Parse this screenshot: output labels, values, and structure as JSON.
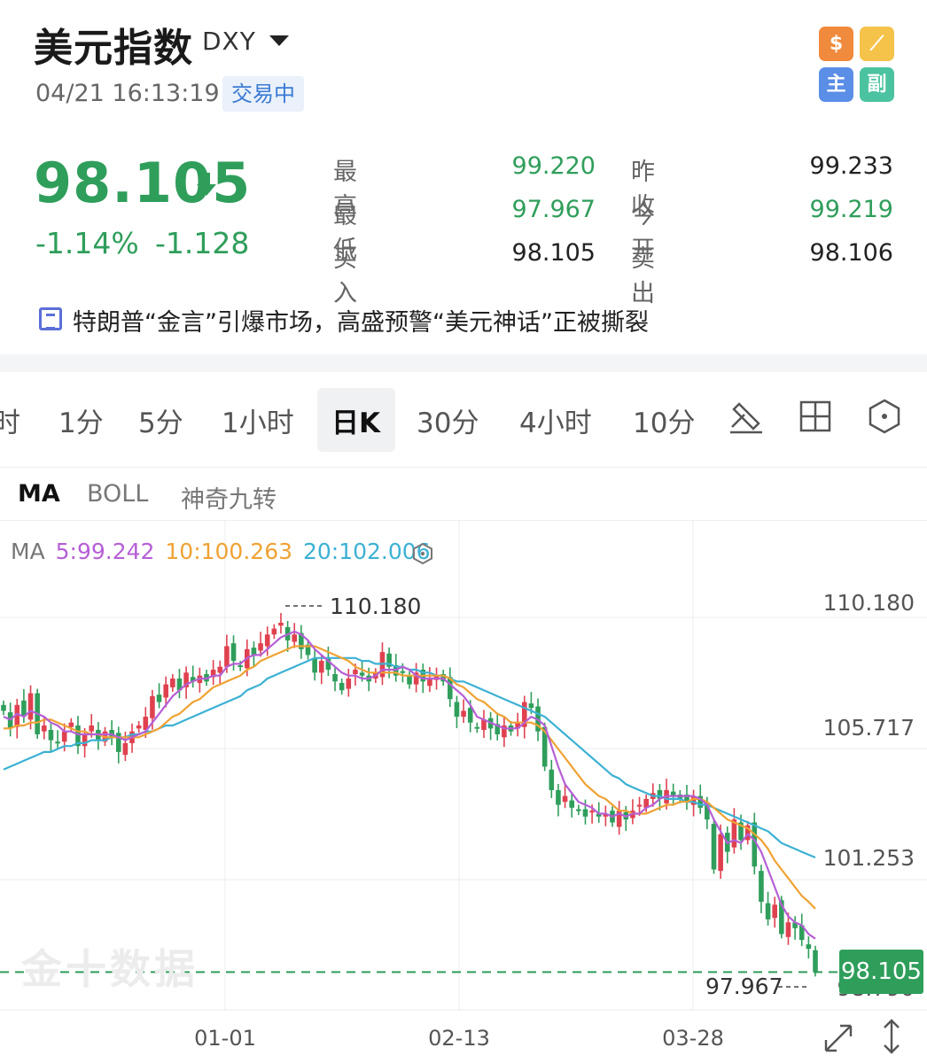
{
  "header": {
    "title": "美元指数",
    "symbol": "DXY",
    "datetime": "04/21 16:13:19",
    "status": "交易中"
  },
  "tools": [
    {
      "name": "dollar-icon",
      "glyph": "$"
    },
    {
      "name": "draw-line-icon",
      "glyph": "⟋"
    },
    {
      "name": "main-chart-icon",
      "glyph": "主"
    },
    {
      "name": "sub-chart-icon",
      "glyph": "副"
    }
  ],
  "quote": {
    "price": "98.105",
    "change_pct": "-1.14%",
    "change": "-1.128",
    "stats": {
      "high_label": "最高",
      "high": "99.220",
      "prev_close_label": "昨收",
      "prev_close": "99.233",
      "low_label": "最低",
      "low": "97.967",
      "open_label": "今开",
      "open": "99.219",
      "bid_label": "买入",
      "bid": "98.105",
      "ask_label": "卖出",
      "ask": "98.106"
    }
  },
  "news": {
    "headline": "特朗普“金言”引爆市场，高盛预警“美元神话”正被撕裂"
  },
  "period_tabs": [
    "时",
    "1分",
    "5分",
    "1小时",
    "日K",
    "30分",
    "4小时",
    "10分"
  ],
  "active_period": "日K",
  "indicator_tabs": [
    "MA",
    "BOLL",
    "神奇九转"
  ],
  "active_indicator": "MA",
  "ma": {
    "label": "MA",
    "ma5": "5:99.242",
    "ma10": "10:100.263",
    "ma20": "20:102.006",
    "colors": {
      "ma5": "#b65fd6",
      "ma10": "#f0a233",
      "ma20": "#3cb1d4"
    }
  },
  "colors": {
    "up": "#e0414f",
    "down": "#2f9e5b",
    "accent": "#3a7bd5"
  },
  "watermark": "金十数据",
  "chart_data": {
    "type": "candlestick",
    "y_ticks": [
      "110.180",
      "105.717",
      "101.253",
      "98.790"
    ],
    "x_ticks": [
      "01-01",
      "02-13",
      "03-28"
    ],
    "high_label": "110.180",
    "low_label": "97.967",
    "last_price": "98.105",
    "ylim": [
      97.0,
      111.5
    ],
    "close_series": [
      107.0,
      106.4,
      107.2,
      106.8,
      107.6,
      106.2,
      106.5,
      106.0,
      105.9,
      106.3,
      106.6,
      105.8,
      106.2,
      106.5,
      106.0,
      106.3,
      106.1,
      105.6,
      105.9,
      106.3,
      106.5,
      106.8,
      107.5,
      107.3,
      107.9,
      108.1,
      107.7,
      108.3,
      108.0,
      108.2,
      108.0,
      108.4,
      108.5,
      109.2,
      108.7,
      108.5,
      109.1,
      108.9,
      109.3,
      109.6,
      109.8,
      110.0,
      109.4,
      109.6,
      109.1,
      108.9,
      108.3,
      108.7,
      108.4,
      108.0,
      107.7,
      108.1,
      108.4,
      108.2,
      108.0,
      108.3,
      109.0,
      108.5,
      108.2,
      108.3,
      107.9,
      108.3,
      108.0,
      108.1,
      108.2,
      108.0,
      107.4,
      106.8,
      107.0,
      106.6,
      106.4,
      106.7,
      106.4,
      106.2,
      106.5,
      106.3,
      106.6,
      107.3,
      107.1,
      106.3,
      105.1,
      104.3,
      103.8,
      104.1,
      103.7,
      103.6,
      103.4,
      103.6,
      103.4,
      103.5,
      103.2,
      103.6,
      103.3,
      103.6,
      103.8,
      104.0,
      104.2,
      104.0,
      104.3,
      104.1,
      104.0,
      103.9,
      104.1,
      103.7,
      103.3,
      101.6,
      102.8,
      102.2,
      103.3,
      102.6,
      103.1,
      101.7,
      100.5,
      99.9,
      100.4,
      99.4,
      99.8,
      99.6,
      99.2,
      98.9,
      98.105
    ],
    "ma5": [
      106.8,
      106.7,
      106.9,
      106.8,
      107.0,
      106.9,
      106.8,
      106.6,
      106.5,
      106.3,
      106.3,
      106.2,
      106.2,
      106.2,
      106.2,
      106.2,
      106.2,
      106.1,
      106.0,
      106.1,
      106.2,
      106.3,
      106.6,
      106.9,
      107.2,
      107.5,
      107.7,
      107.9,
      108.0,
      108.1,
      108.1,
      108.2,
      108.2,
      108.5,
      108.6,
      108.6,
      108.8,
      108.9,
      108.9,
      109.1,
      109.3,
      109.5,
      109.6,
      109.7,
      109.6,
      109.4,
      109.1,
      108.9,
      108.7,
      108.5,
      108.3,
      108.2,
      108.2,
      108.1,
      108.1,
      108.2,
      108.4,
      108.4,
      108.4,
      108.5,
      108.4,
      108.2,
      108.1,
      108.1,
      108.1,
      108.1,
      107.9,
      107.7,
      107.5,
      107.2,
      106.8,
      106.7,
      106.6,
      106.5,
      106.4,
      106.4,
      106.4,
      106.6,
      106.8,
      106.7,
      106.5,
      105.8,
      105.1,
      104.5,
      104.2,
      103.9,
      103.8,
      103.7,
      103.5,
      103.5,
      103.4,
      103.5,
      103.4,
      103.5,
      103.5,
      103.7,
      103.8,
      104.0,
      104.1,
      104.1,
      104.1,
      104.1,
      104.1,
      104.0,
      103.8,
      103.3,
      102.9,
      102.5,
      102.6,
      102.5,
      102.8,
      102.6,
      102.2,
      101.6,
      101.0,
      100.4,
      100.0,
      99.8,
      99.7,
      99.4,
      99.242
    ],
    "ma10": [
      106.4,
      106.4,
      106.5,
      106.5,
      106.6,
      106.6,
      106.7,
      106.7,
      106.6,
      106.5,
      106.4,
      106.3,
      106.3,
      106.2,
      106.2,
      106.1,
      106.1,
      106.1,
      106.1,
      106.1,
      106.1,
      106.2,
      106.3,
      106.4,
      106.6,
      106.8,
      106.9,
      107.1,
      107.3,
      107.4,
      107.6,
      107.8,
      107.9,
      108.0,
      108.1,
      108.2,
      108.4,
      108.5,
      108.7,
      108.8,
      108.9,
      109.0,
      109.1,
      109.2,
      109.2,
      109.2,
      109.2,
      109.1,
      109.0,
      108.9,
      108.8,
      108.7,
      108.5,
      108.4,
      108.3,
      108.3,
      108.3,
      108.3,
      108.3,
      108.2,
      108.2,
      108.2,
      108.2,
      108.2,
      108.2,
      108.2,
      108.1,
      107.9,
      107.8,
      107.6,
      107.4,
      107.3,
      107.1,
      106.9,
      106.8,
      106.6,
      106.6,
      106.6,
      106.6,
      106.5,
      106.3,
      106.0,
      105.7,
      105.4,
      105.1,
      104.8,
      104.5,
      104.3,
      104.1,
      104.0,
      103.8,
      103.6,
      103.6,
      103.5,
      103.5,
      103.5,
      103.6,
      103.7,
      103.8,
      103.8,
      103.9,
      103.9,
      104.0,
      104.0,
      103.9,
      103.7,
      103.5,
      103.3,
      103.2,
      103.1,
      103.0,
      102.8,
      102.6,
      102.3,
      101.9,
      101.6,
      101.3,
      101.0,
      100.7,
      100.5,
      100.263
    ],
    "ma20": [
      105.0,
      105.1,
      105.2,
      105.3,
      105.4,
      105.5,
      105.6,
      105.6,
      105.7,
      105.8,
      105.8,
      105.9,
      105.9,
      106.0,
      106.0,
      106.0,
      106.1,
      106.1,
      106.1,
      106.2,
      106.2,
      106.3,
      106.3,
      106.4,
      106.5,
      106.5,
      106.6,
      106.7,
      106.8,
      106.9,
      107.0,
      107.1,
      107.2,
      107.3,
      107.4,
      107.5,
      107.7,
      107.8,
      107.9,
      108.1,
      108.2,
      108.3,
      108.4,
      108.5,
      108.6,
      108.7,
      108.8,
      108.8,
      108.8,
      108.8,
      108.8,
      108.8,
      108.8,
      108.7,
      108.7,
      108.6,
      108.6,
      108.6,
      108.5,
      108.5,
      108.4,
      108.4,
      108.3,
      108.3,
      108.2,
      108.2,
      108.1,
      108.0,
      108.0,
      107.9,
      107.8,
      107.7,
      107.6,
      107.5,
      107.4,
      107.3,
      107.2,
      107.1,
      107.0,
      106.9,
      106.8,
      106.6,
      106.4,
      106.2,
      106.0,
      105.8,
      105.6,
      105.4,
      105.2,
      105.0,
      104.8,
      104.7,
      104.5,
      104.4,
      104.3,
      104.2,
      104.1,
      104.1,
      104.0,
      104.0,
      104.0,
      103.9,
      103.9,
      103.8,
      103.8,
      103.7,
      103.6,
      103.5,
      103.4,
      103.3,
      103.2,
      103.1,
      103.0,
      102.9,
      102.7,
      102.5,
      102.4,
      102.3,
      102.2,
      102.1,
      102.006
    ]
  }
}
